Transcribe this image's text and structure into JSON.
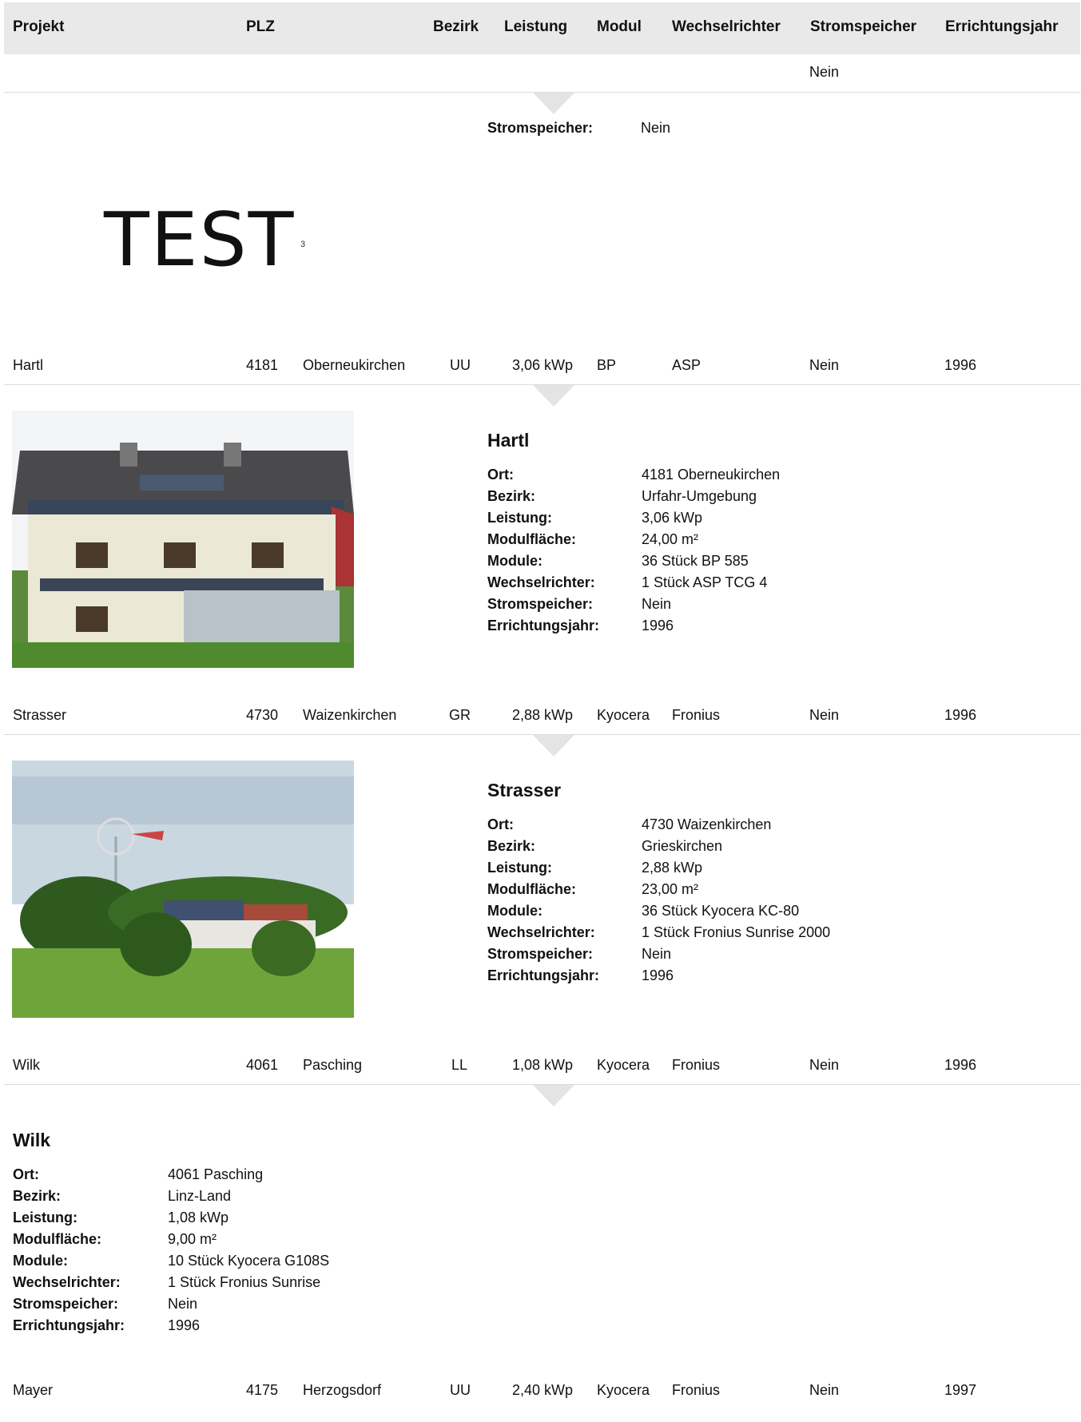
{
  "table": {
    "headers": {
      "projekt": "Projekt",
      "plz": "PLZ",
      "bezirk": "Bezirk",
      "leistung": "Leistung",
      "modul": "Modul",
      "wechselrichter": "Wechselrichter",
      "stromspeicher": "Stromspeicher",
      "errichtungsjahr": "Errichtungsjahr"
    },
    "first_row": {
      "stromspeicher": "Nein"
    },
    "first_detail": {
      "label": "Stromspeicher:",
      "value": "Nein",
      "logo_text": "TEST",
      "logo_sup": "3"
    },
    "labels": {
      "ort": "Ort:",
      "bezirk": "Bezirk:",
      "leistung": "Leistung:",
      "modulflaeche": "Modulfläche:",
      "module": "Module:",
      "wechselrichter": "Wechselrichter:",
      "stromspeicher": "Stromspeicher:",
      "errichtungsjahr": "Errichtungsjahr:"
    },
    "rows": [
      {
        "projekt": "Hartl",
        "plz": "4181",
        "ort": "Oberneukirchen",
        "bezirk": "UU",
        "leistung": "3,06 kWp",
        "modul": "BP",
        "wechselrichter": "ASP",
        "stromspeicher": "Nein",
        "jahr": "1996",
        "detail": {
          "title": "Hartl",
          "ort": "4181 Oberneukirchen",
          "bezirk": "Urfahr-Umgebung",
          "leistung": "3,06 kWp",
          "modulflaeche": "24,00 m²",
          "module": "36 Stück BP 585",
          "wechselrichter": "1 Stück ASP TCG 4",
          "stromspeicher": "Nein",
          "errichtungsjahr": "1996"
        }
      },
      {
        "projekt": "Strasser",
        "plz": "4730",
        "ort": "Waizenkirchen",
        "bezirk": "GR",
        "leistung": "2,88 kWp",
        "modul": "Kyocera",
        "wechselrichter": "Fronius",
        "stromspeicher": "Nein",
        "jahr": "1996",
        "detail": {
          "title": "Strasser",
          "ort": "4730 Waizenkirchen",
          "bezirk": "Grieskirchen",
          "leistung": "2,88 kWp",
          "modulflaeche": "23,00 m²",
          "module": "36 Stück Kyocera KC-80",
          "wechselrichter": "1 Stück Fronius Sunrise 2000",
          "stromspeicher": "Nein",
          "errichtungsjahr": "1996"
        }
      },
      {
        "projekt": "Wilk",
        "plz": "4061",
        "ort": "Pasching",
        "bezirk": "LL",
        "leistung": "1,08 kWp",
        "modul": "Kyocera",
        "wechselrichter": "Fronius",
        "stromspeicher": "Nein",
        "jahr": "1996",
        "detail": {
          "title": "Wilk",
          "ort": "4061 Pasching",
          "bezirk": "Linz-Land",
          "leistung": "1,08 kWp",
          "modulflaeche": "9,00 m²",
          "module": "10 Stück Kyocera G108S",
          "wechselrichter": "1 Stück Fronius Sunrise",
          "stromspeicher": "Nein",
          "errichtungsjahr": "1996"
        }
      },
      {
        "projekt": "Mayer",
        "plz": "4175",
        "ort": "Herzogsdorf",
        "bezirk": "UU",
        "leistung": "2,40 kWp",
        "modul": "Kyocera",
        "wechselrichter": "Fronius",
        "stromspeicher": "Nein",
        "jahr": "1997"
      }
    ]
  }
}
